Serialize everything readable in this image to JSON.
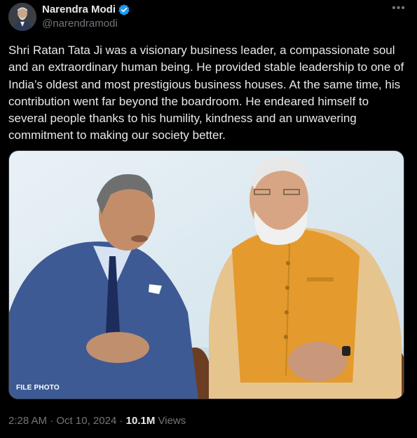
{
  "author": {
    "name": "Narendra Modi",
    "handle": "@narendramodi",
    "verified": true
  },
  "tweet": {
    "text": "Shri Ratan Tata Ji was a visionary business leader, a compassionate soul and an extraordinary human being. He provided stable leadership to one of India’s oldest and most prestigious business houses. At the same time, his contribution went far beyond the boardroom. He endeared himself to several people thanks to his humility, kindness and an unwavering commitment to making our society better.",
    "photo_caption": "FILE PHOTO"
  },
  "meta": {
    "time": "2:28 AM",
    "separator": "·",
    "date": "Oct 10, 2024",
    "views_count": "10.1M",
    "views_label": "Views"
  },
  "icons": {
    "more": "more-options-icon",
    "verified": "verified-badge-icon"
  },
  "colors": {
    "background": "#000000",
    "primary_text": "#e7e9ea",
    "secondary_text": "#71767b",
    "verified_blue": "#1d9bf0"
  }
}
